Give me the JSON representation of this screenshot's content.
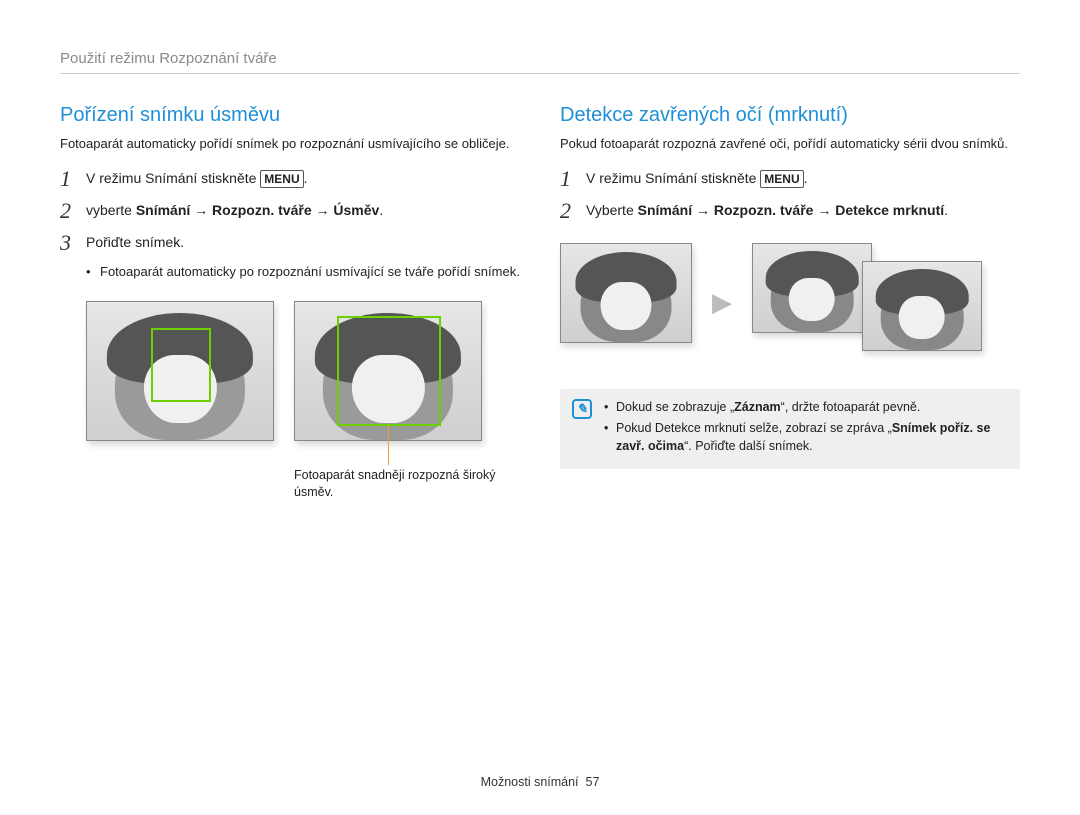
{
  "breadcrumb": "Použití režimu Rozpoznání tváře",
  "left": {
    "title": "Pořízení snímku úsměvu",
    "intro": "Fotoaparát automaticky pořídí snímek po rozpoznání usmívajícího se obličeje.",
    "step1_pre": "V režimu Snímání stiskněte ",
    "menu_label": "MENU",
    "step1_post": ".",
    "step2_pre": "vyberte ",
    "step2_bold": "Snímání → Rozpozn. tváře → Úsměv",
    "step2_post": ".",
    "step3": "Pořiďte snímek.",
    "step3_bullet": "Fotoaparát automaticky po rozpoznání usmívající se tváře pořídí snímek.",
    "caption": "Fotoaparát snadněji rozpozná široký úsměv."
  },
  "right": {
    "title": "Detekce zavřených očí (mrknutí)",
    "intro": "Pokud fotoaparát rozpozná zavřené oči, pořídí automaticky sérii dvou snímků.",
    "step1_pre": "V režimu Snímání stiskněte ",
    "menu_label": "MENU",
    "step1_post": ".",
    "step2_pre": "Vyberte ",
    "step2_bold": "Snímání → Rozpozn. tváře → Detekce mrknutí",
    "step2_post": ".",
    "note1_pre": "Dokud se zobrazuje „",
    "note1_bold": "Záznam",
    "note1_post": "“, držte fotoaparát pevně.",
    "note2_pre": "Pokud Detekce mrknutí selže, zobrazí se zpráva „",
    "note2_bold": "Snímek poříz. se zavř. očima",
    "note2_post": "“. Pořiďte další snímek."
  },
  "footer_label": "Možnosti snímání",
  "footer_page": "57"
}
